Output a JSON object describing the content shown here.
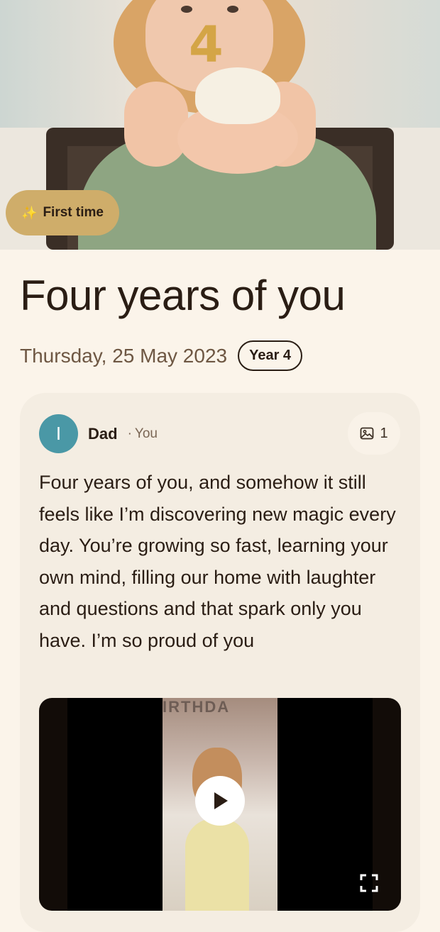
{
  "hero": {
    "badge_label": "First time",
    "badge_icon": "sparkles-icon",
    "candle_glyph": "4"
  },
  "entry": {
    "title": "Four years of you",
    "date": "Thursday, 25 May 2023",
    "year_label": "Year 4"
  },
  "card": {
    "avatar_initial": "I",
    "author": "Dad",
    "separator": "·",
    "author_role": "You",
    "media_count": "1",
    "media_icon": "image-icon",
    "text": "Four years of you, and somehow it still feels like I’m discovering new magic every day. You’re growing so fast, learning your own mind, filling our home with laughter and questions and that spark only you have. I’m so proud of you",
    "video_banner": "IRTHDA",
    "play_icon": "play-icon",
    "fullscreen_icon": "fullscreen-icon"
  },
  "colors": {
    "background": "#fbf4ea",
    "card": "#f4ede2",
    "badge_gold": "#cfad6a",
    "avatar": "#4a98a6",
    "text_dark": "#2a1d14",
    "text_muted": "#6e5743"
  }
}
